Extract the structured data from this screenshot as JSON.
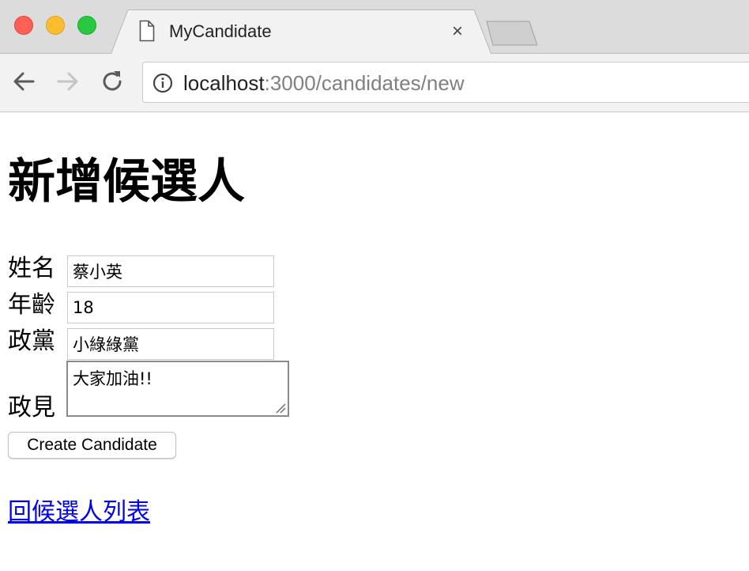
{
  "browser": {
    "tab_title": "MyCandidate",
    "tab_close": "×",
    "url_host": "localhost",
    "url_path": ":3000/candidates/new"
  },
  "icons": {
    "tab": "document-icon",
    "back": "arrow-left-icon",
    "forward": "arrow-right-icon",
    "reload": "reload-icon",
    "site_info": "info-icon"
  },
  "page": {
    "title": "新增候選人",
    "form": {
      "name_label": "姓名",
      "name_value": "蔡小英",
      "age_label": "年齡",
      "age_value": "18",
      "party_label": "政黨",
      "party_value": "小綠綠黨",
      "policy_label": "政見",
      "policy_value": "大家加油!!",
      "submit_label": "Create Candidate"
    },
    "back_link": "回候選人列表"
  },
  "colors": {
    "link": "#0000ee",
    "close_button": "#fe5f57",
    "minimize_button": "#febc2e",
    "zoom_button": "#28c840"
  }
}
